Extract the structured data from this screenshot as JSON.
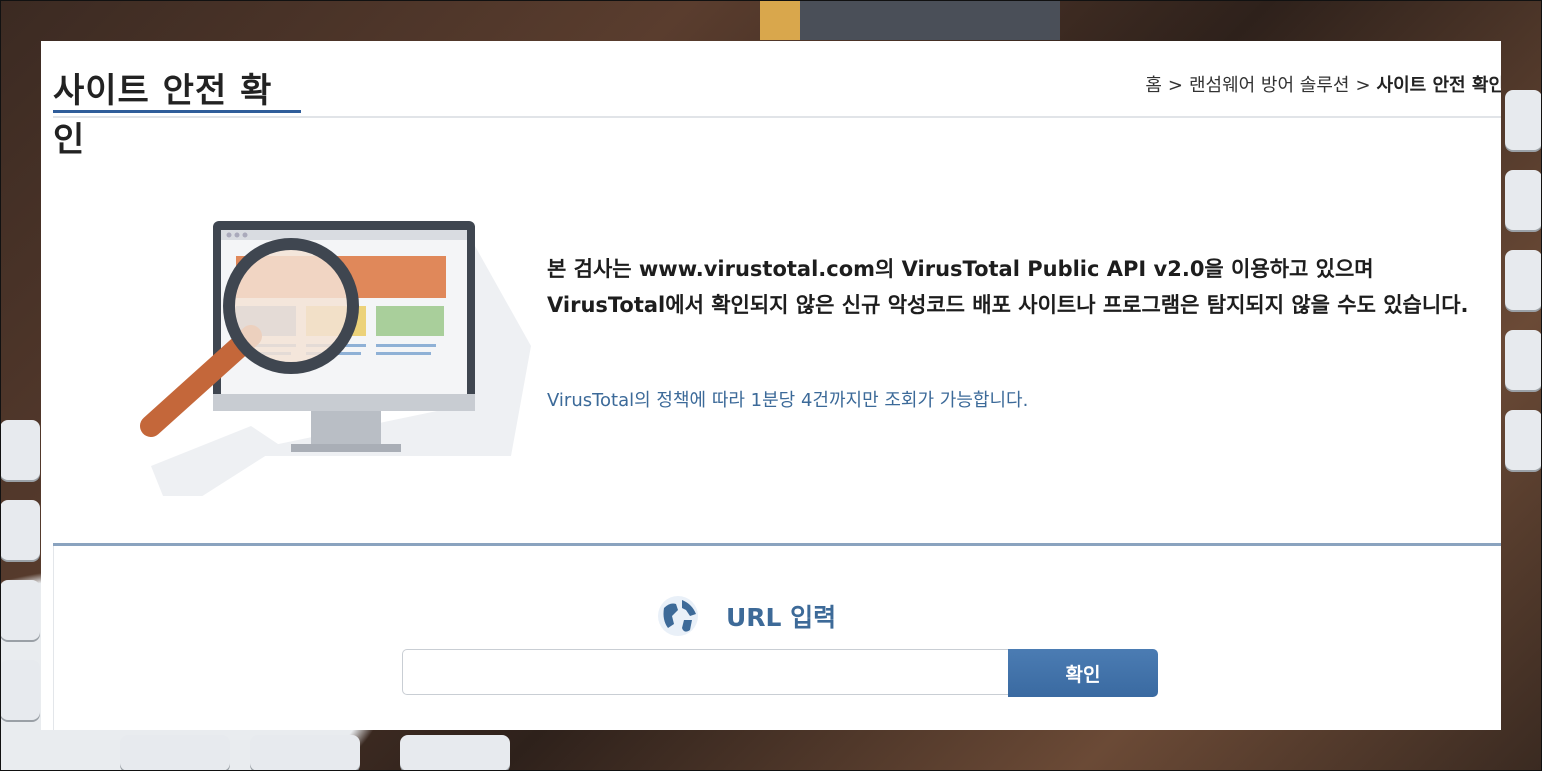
{
  "header": {
    "title": "사이트 안전 확인",
    "breadcrumb": {
      "home": "홈",
      "separator": ">",
      "parent": "랜섬웨어 방어 솔루션",
      "current": "사이트 안전 확인"
    }
  },
  "content": {
    "description": "본 검사는 www.virustotal.com의 VirusTotal Public API v2.0을 이용하고 있으며 VirusTotal에서 확인되지 않은 신규 악성코드 배포 사이트나 프로그램은 탐지되지 않을 수도 있습니다.",
    "note": "VirusTotal의 정책에 따라 1분당 4건까지만 조회가 가능합니다."
  },
  "url_form": {
    "heading": "URL 입력",
    "input_value": "",
    "input_placeholder": "",
    "submit_label": "확인"
  },
  "icons": {
    "illustration": "magnifier-monitor-illustration",
    "globe": "globe-icon"
  },
  "colors": {
    "accent": "#2f5d9a",
    "link_text": "#3c6a99",
    "button": "#3f6fa6"
  }
}
